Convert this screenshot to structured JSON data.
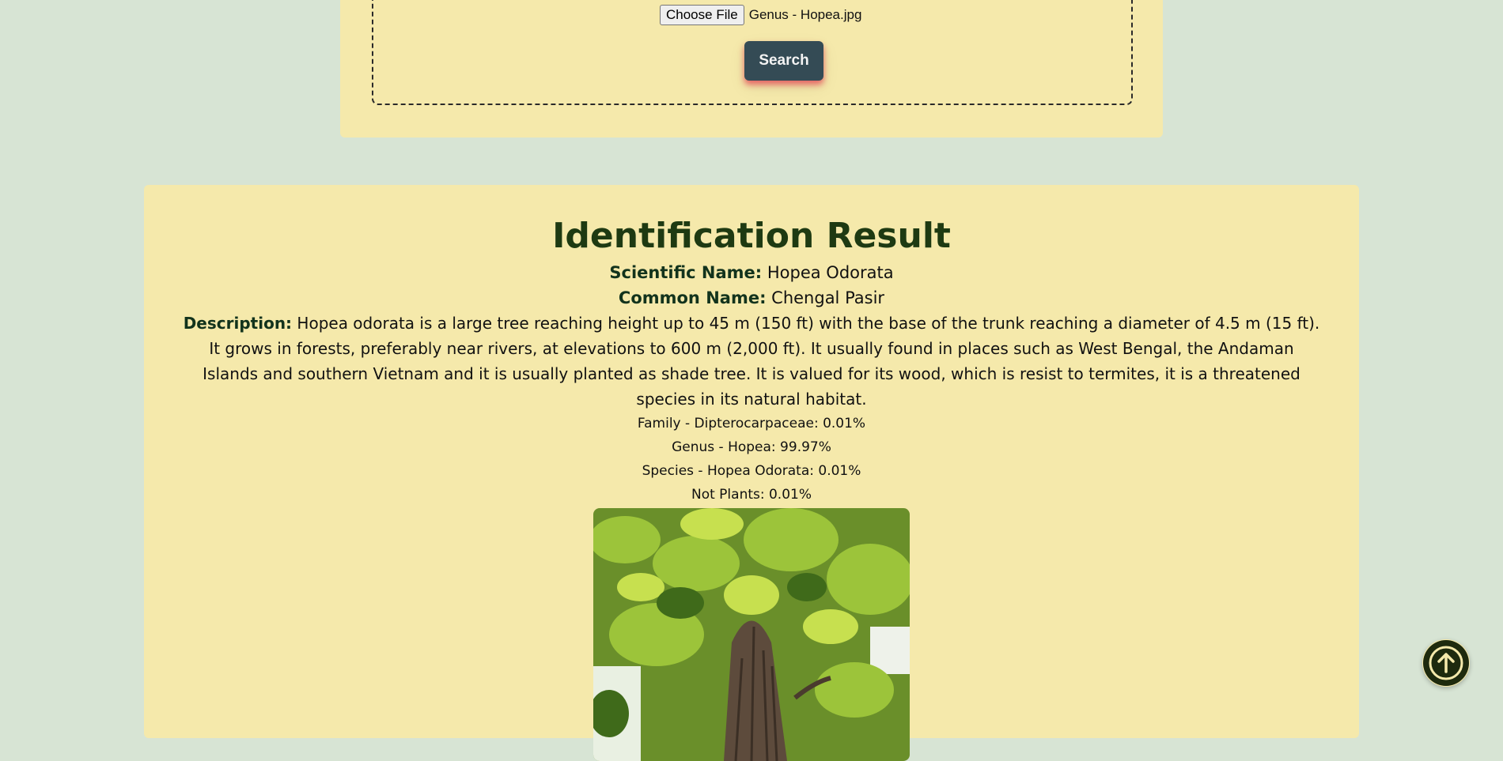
{
  "upload": {
    "choose_file_label": "Choose File",
    "file_name": "Genus - Hopea.jpg",
    "search_label": "Search"
  },
  "result": {
    "title": "Identification Result",
    "scientific_name_label": "Scientific Name:",
    "scientific_name": "Hopea Odorata",
    "common_name_label": "Common Name:",
    "common_name": "Chengal Pasir",
    "description_label": "Description:",
    "description": "Hopea odorata is a large tree reaching height up to 45 m (150 ft) with the base of the trunk reaching a diameter of 4.5 m (15 ft). It grows in forests, preferably near rivers, at elevations to 600 m (2,000 ft). It usually found in places such as West Bengal, the Andaman Islands and southern Vietnam and it is usually planted as shade tree. It is valued for its wood, which is resist to termites, it is a threatened species in its natural habitat.",
    "probabilities": [
      "Family - Dipterocarpaceae: 0.01%",
      "Genus - Hopea: 99.97%",
      "Species - Hopea Odorata: 0.01%",
      "Not Plants: 0.01%"
    ]
  },
  "icons": {
    "scroll_top": "arrow-up-circle-icon"
  },
  "colors": {
    "background": "#d7e4d4",
    "card": "#f5e9ab",
    "title": "#1e3a12",
    "search_button": "#344b55",
    "scroll_button": "#1e2a0e"
  }
}
